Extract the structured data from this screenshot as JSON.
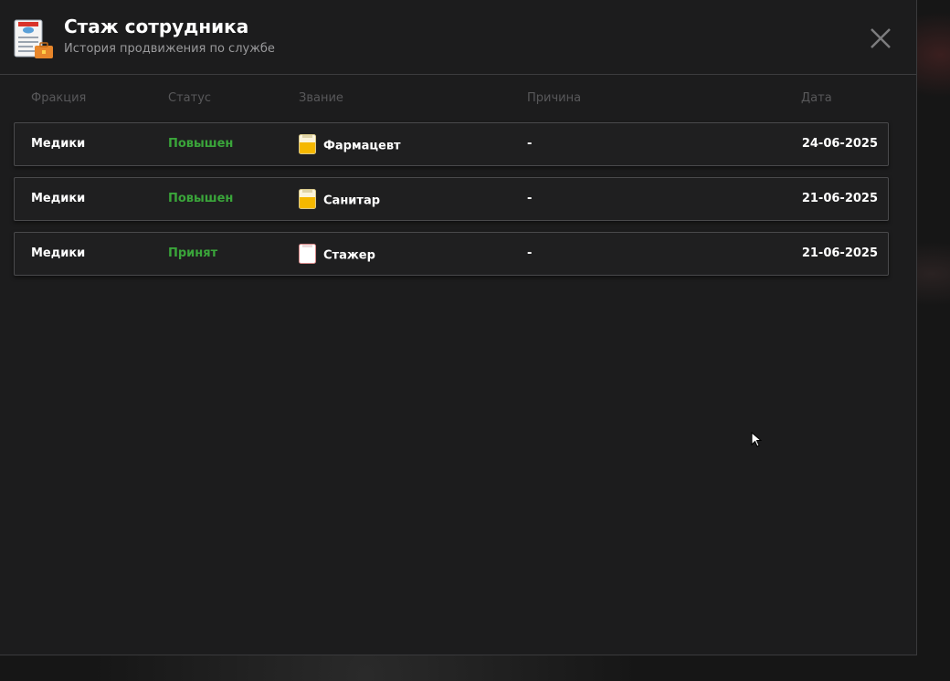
{
  "window": {
    "title": "Стаж сотрудника",
    "subtitle": "История продвижения по службе",
    "close_icon": "close-icon",
    "app_icon": "document-briefcase-icon"
  },
  "table": {
    "headers": {
      "faction": "Фракция",
      "status": "Статус",
      "rank": "Звание",
      "reason": "Причина",
      "date": "Дата"
    },
    "rows": [
      {
        "faction": "Медики",
        "status": "Повышен",
        "rank": "Фармацевт",
        "rank_icon": "rank-badge-yellow-icon",
        "reason": "-",
        "date": "24-06-2025"
      },
      {
        "faction": "Медики",
        "status": "Повышен",
        "rank": "Санитар",
        "rank_icon": "rank-badge-yellow-icon",
        "reason": "-",
        "date": "21-06-2025"
      },
      {
        "faction": "Медики",
        "status": "Принят",
        "rank": "Стажер",
        "rank_icon": "rank-badge-white-icon",
        "reason": "-",
        "date": "21-06-2025"
      }
    ]
  },
  "colors": {
    "status_green": "#3aa53a",
    "rank_yellow": "#f5b800",
    "background": "#1c1c1d"
  }
}
